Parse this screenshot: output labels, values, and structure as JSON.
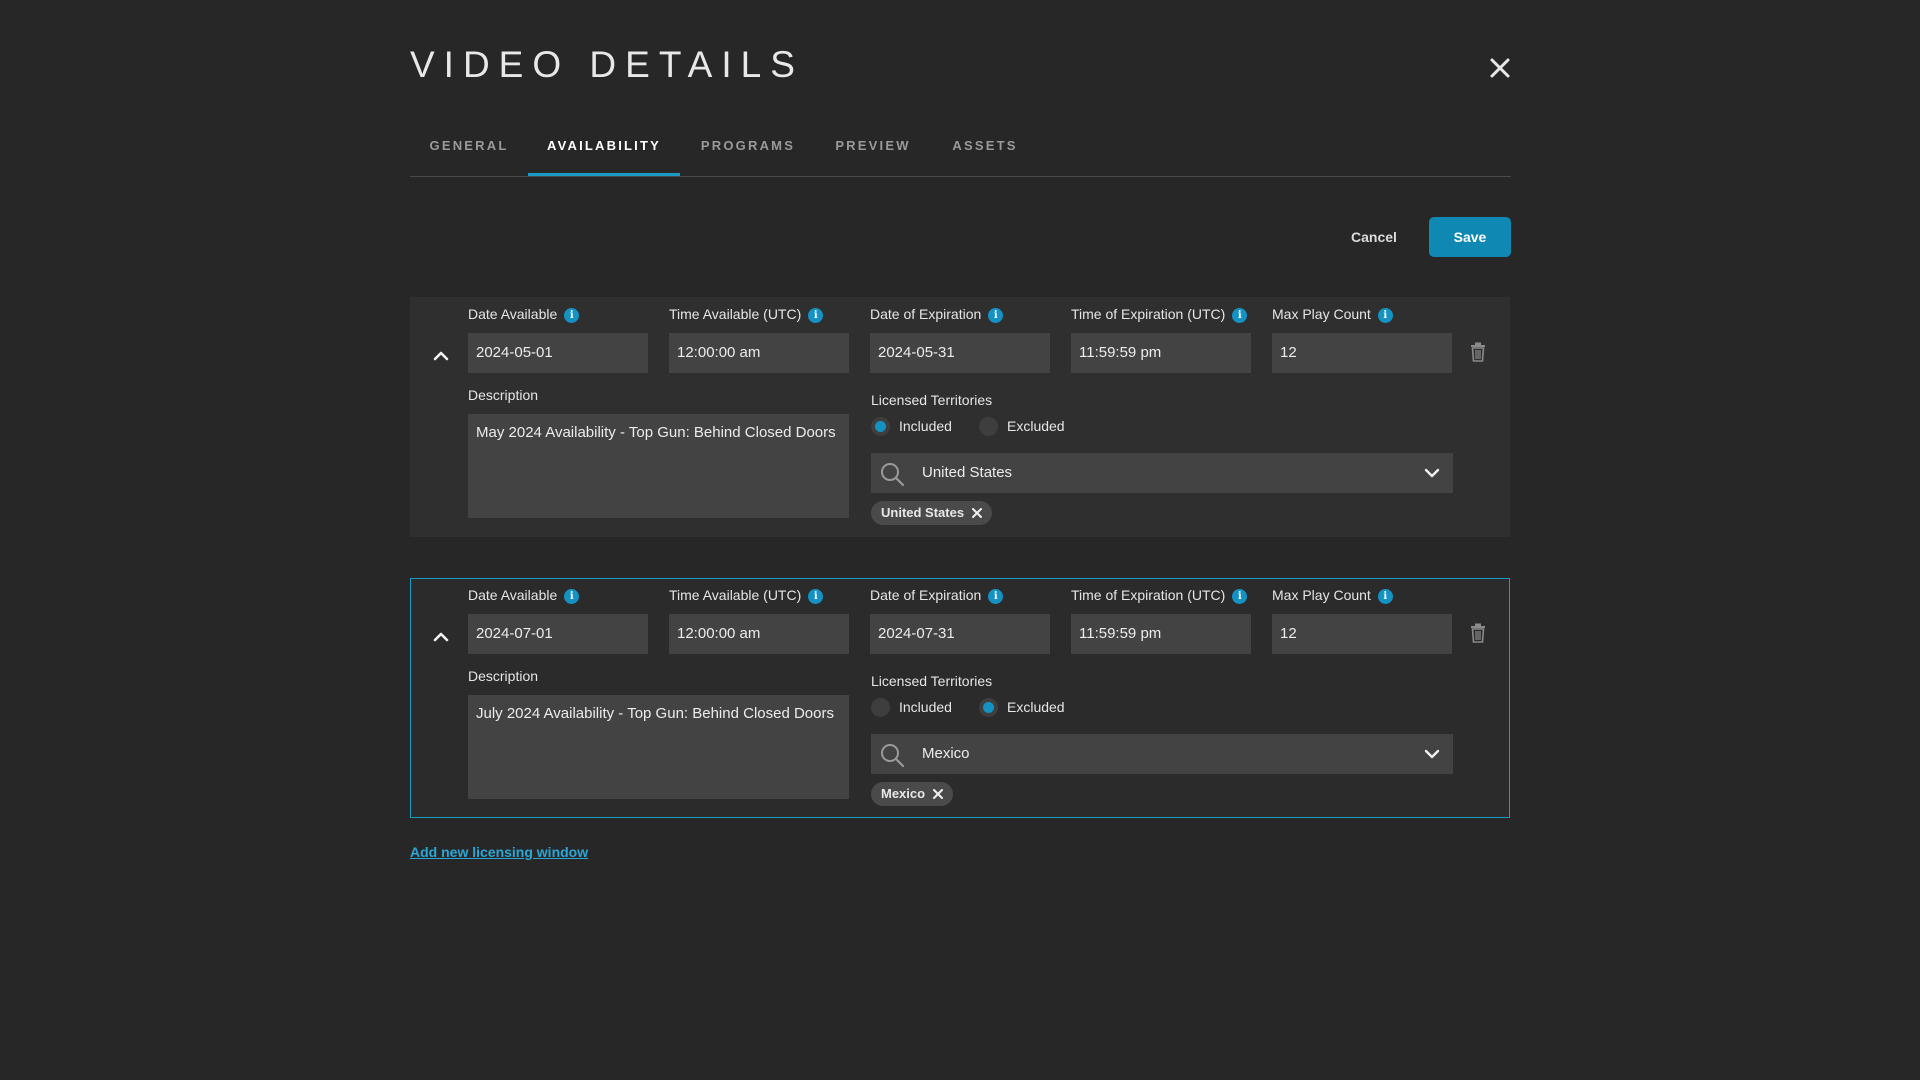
{
  "page": {
    "title": "VIDEO DETAILS"
  },
  "tabs": [
    {
      "label": "GENERAL",
      "active": false
    },
    {
      "label": "AVAILABILITY",
      "active": true
    },
    {
      "label": "PROGRAMS",
      "active": false
    },
    {
      "label": "PREVIEW",
      "active": false
    },
    {
      "label": "ASSETS",
      "active": false
    }
  ],
  "actions": {
    "cancel_label": "Cancel",
    "save_label": "Save"
  },
  "labels": {
    "date_available": "Date Available",
    "time_available": "Time Available (UTC)",
    "date_expiration": "Date of Expiration",
    "time_expiration": "Time of Expiration (UTC)",
    "max_play_count": "Max Play Count",
    "description": "Description",
    "licensed_territories": "Licensed Territories",
    "included": "Included",
    "excluded": "Excluded",
    "info_glyph": "i"
  },
  "windows": [
    {
      "date_available": "2024-05-01",
      "time_available": "12:00:00 am",
      "date_expiration": "2024-05-31",
      "time_expiration": "11:59:59 pm",
      "max_play_count": "12",
      "description": "May 2024 Availability - Top Gun: Behind Closed Doors",
      "territory_mode": "included",
      "territory_search": "United States",
      "territories": [
        "United States"
      ],
      "selected": false
    },
    {
      "date_available": "2024-07-01",
      "time_available": "12:00:00 am",
      "date_expiration": "2024-07-31",
      "time_expiration": "11:59:59 pm",
      "max_play_count": "12",
      "description": "July 2024 Availability - Top Gun: Behind Closed Doors",
      "territory_mode": "excluded",
      "territory_search": "Mexico",
      "territories": [
        "Mexico"
      ],
      "selected": true
    }
  ],
  "add_window_label": "Add new licensing window",
  "colors": {
    "accent": "#1592c4",
    "background": "#272727",
    "panel": "#2f2f2f",
    "field": "#434343"
  },
  "icons": {
    "close": "close-icon",
    "collapse": "chevron-up-icon",
    "delete": "trash-icon",
    "search": "search-icon",
    "dropdown": "chevron-down-icon",
    "remove": "x-icon",
    "info": "info-icon"
  }
}
